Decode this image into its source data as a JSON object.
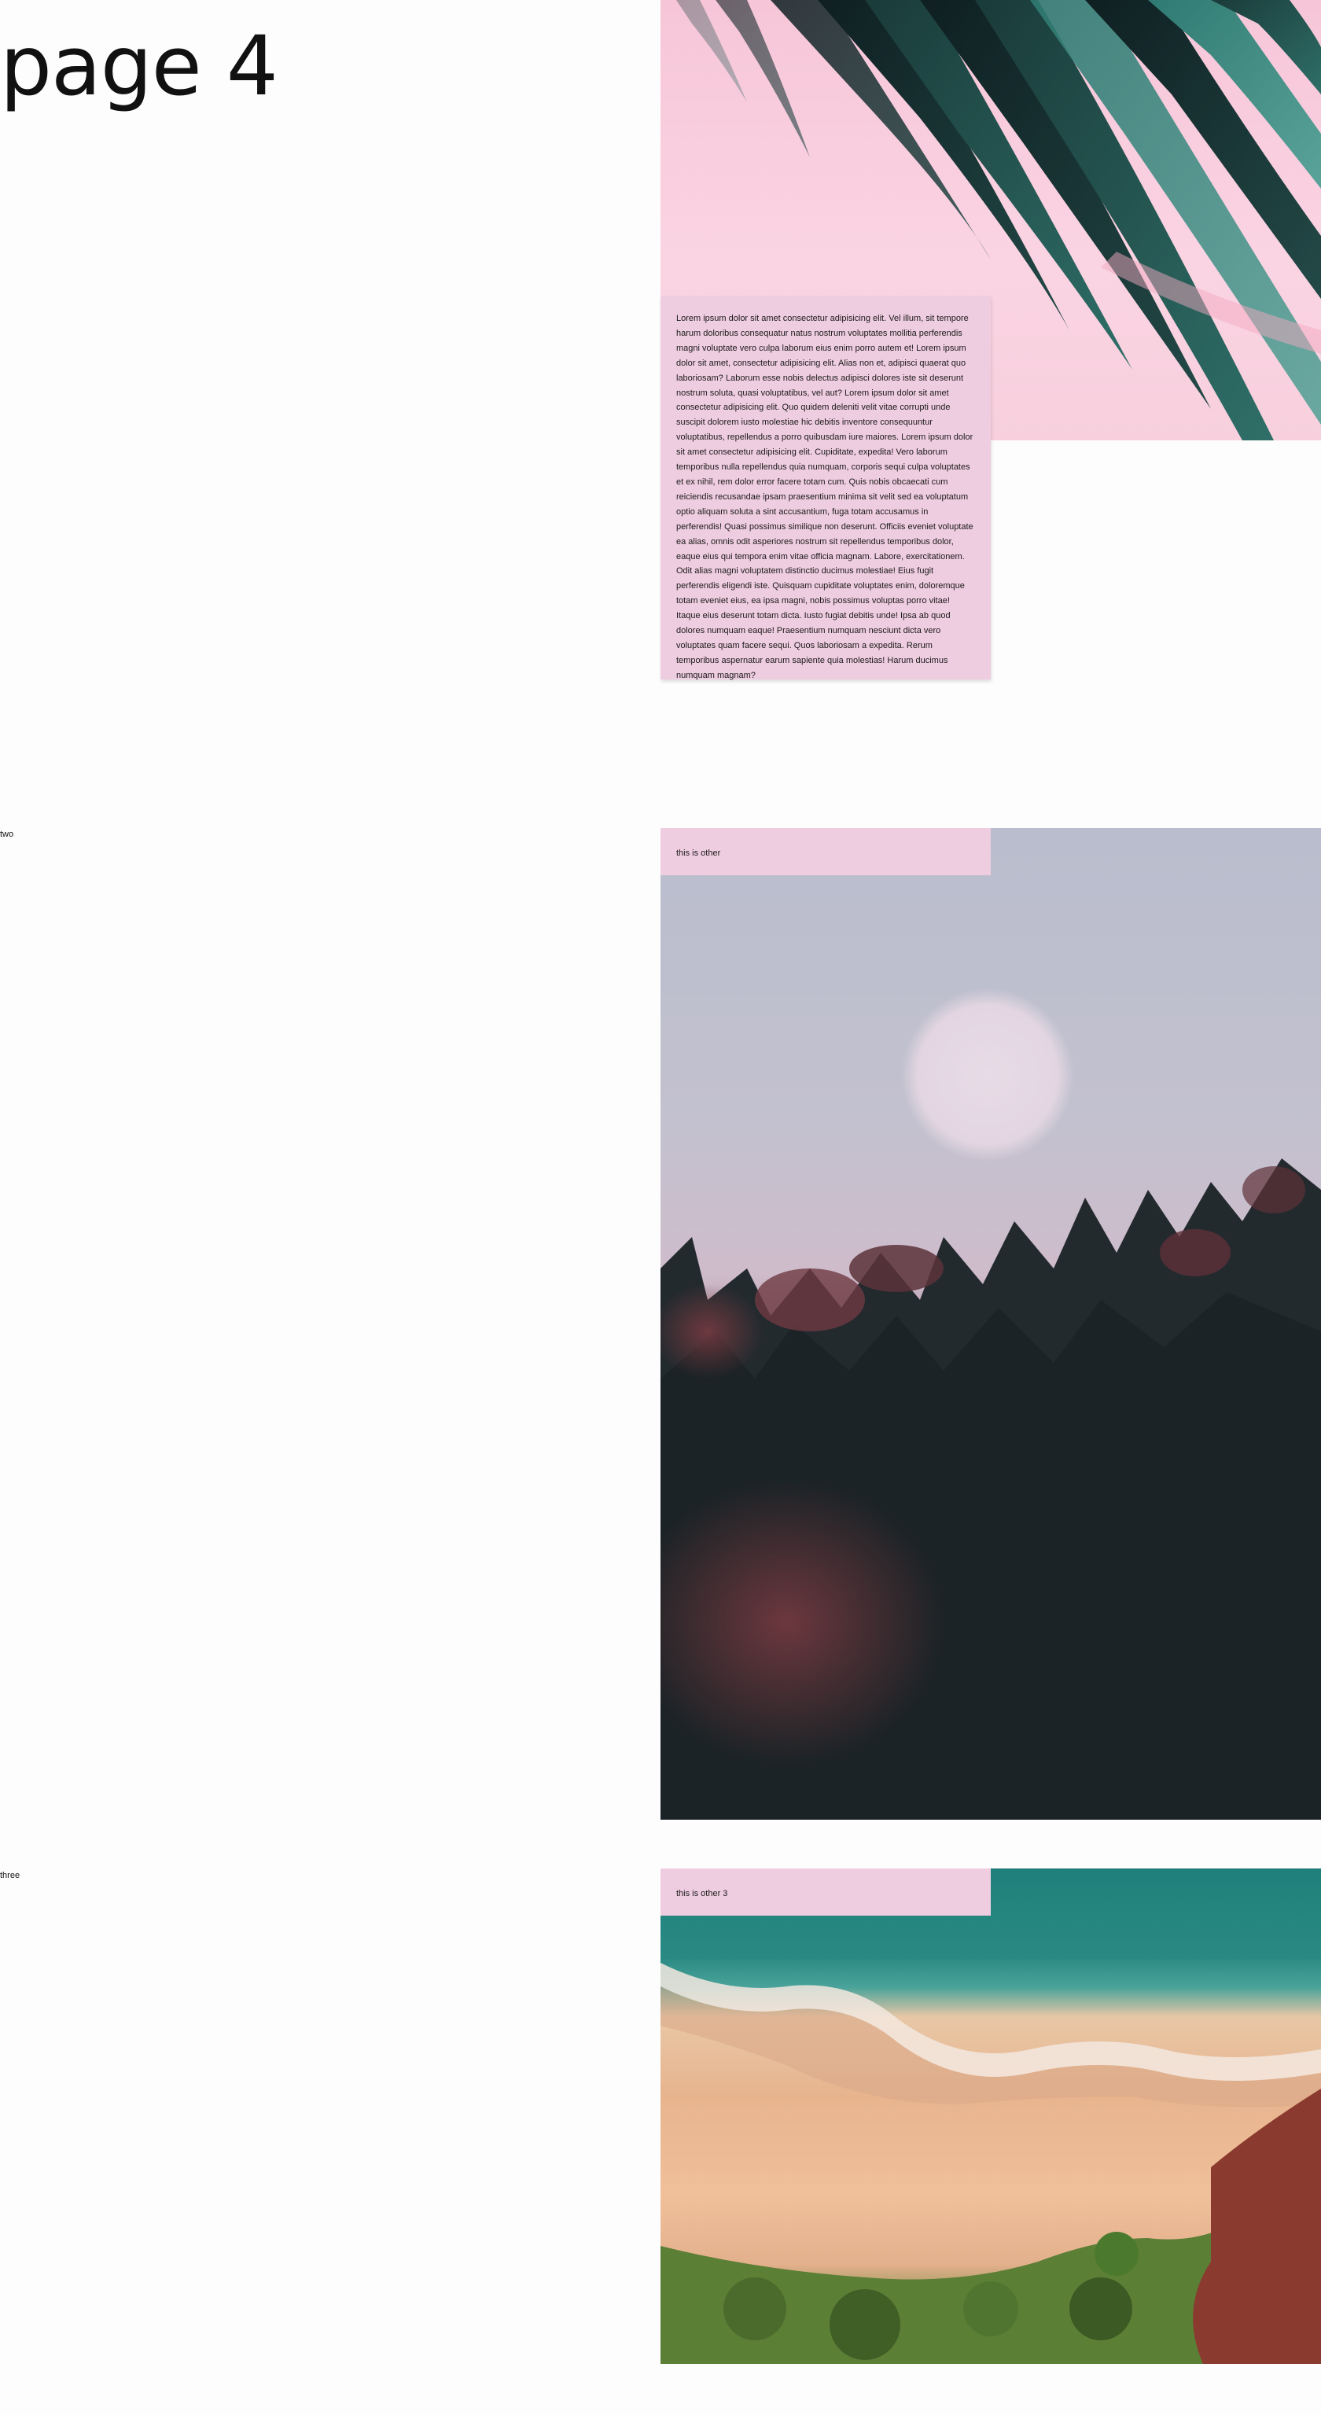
{
  "page": {
    "title": "page 4"
  },
  "sections": [
    {
      "label": "",
      "image": "palm-leaves-on-pink-photo",
      "card_text": "Lorem ipsum dolor sit amet consectetur adipisicing elit. Vel illum, sit tempore harum doloribus consequatur natus nostrum voluptates mollitia perferendis magni voluptate vero culpa laborum eius enim porro autem et! Lorem ipsum dolor sit amet, consectetur adipisicing elit. Alias non et, adipisci quaerat quo laboriosam? Laborum esse nobis delectus adipisci dolores iste sit deserunt nostrum soluta, quasi voluptatibus, vel aut? Lorem ipsum dolor sit amet consectetur adipisicing elit. Quo quidem deleniti velit vitae corrupti unde suscipit dolorem iusto molestiae hic debitis inventore consequuntur voluptatibus, repellendus a porro quibusdam iure maiores. Lorem ipsum dolor sit amet consectetur adipisicing elit. Cupiditate, expedita! Vero laborum temporibus nulla repellendus quia numquam, corporis sequi culpa voluptates et ex nihil, rem dolor error facere totam cum. Quis nobis obcaecati cum reiciendis recusandae ipsam praesentium minima sit velit sed ea voluptatum optio aliquam soluta a sint accusantium, fuga totam accusamus in perferendis! Quasi possimus similique non deserunt. Officiis eveniet voluptate ea alias, omnis odit asperiores nostrum sit repellendus temporibus dolor, eaque eius qui tempora enim vitae officia magnam. Labore, exercitationem. Odit alias magni voluptatem distinctio ducimus molestiae! Eius fugit perferendis eligendi iste. Quisquam cupiditate voluptates enim, doloremque totam eveniet eius, ea ipsa magni, nobis possimus voluptas porro vitae! Itaque eius deserunt totam dicta. Iusto fugiat debitis unde! Ipsa ab quod dolores numquam eaque! Praesentium numquam nesciunt dicta vero voluptates quam facere sequi. Quos laboriosam a expedita. Rerum temporibus aspernatur earum sapiente quia molestias! Harum ducimus numquam magnam?"
    },
    {
      "label": "two",
      "image": "flowers-at-dusk-photo",
      "card_text": "this is other"
    },
    {
      "label": "three",
      "image": "beach-aerial-photo",
      "card_text": "this is other 3"
    }
  ],
  "colors": {
    "card_background": "#efcde0",
    "page_background": "#fdfdfd"
  }
}
